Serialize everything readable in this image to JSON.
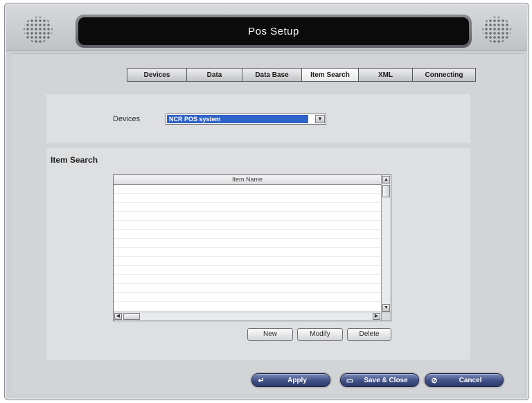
{
  "window": {
    "title": "Pos Setup"
  },
  "tabs": [
    {
      "label": "Devices",
      "active": false
    },
    {
      "label": "Data",
      "active": false
    },
    {
      "label": "Data Base",
      "active": false
    },
    {
      "label": "Item Search",
      "active": true
    },
    {
      "label": "XML",
      "active": false
    },
    {
      "label": "Connecting",
      "active": false
    }
  ],
  "device_section": {
    "label": "Devices",
    "selected_value": "NCR POS system",
    "dropdown_icon": "chevron-down-icon"
  },
  "item_search": {
    "title": "Item Search",
    "column_header": "Item Name",
    "rows": []
  },
  "list_buttons": {
    "new_label": "New",
    "modify_label": "Modify",
    "delete_label": "Delete"
  },
  "footer_buttons": {
    "apply_label": "Apply",
    "apply_icon": "enter-arrow-icon",
    "save_close_label": "Save & Close",
    "save_close_icon": "save-icon",
    "cancel_label": "Cancel",
    "cancel_icon": "cancel-icon"
  },
  "colors": {
    "window_bg": "#cfd0d3",
    "title_bar_bg": "#0b0b0c",
    "selection_highlight": "#2f63c8",
    "pill_button": "#3f4f86"
  }
}
